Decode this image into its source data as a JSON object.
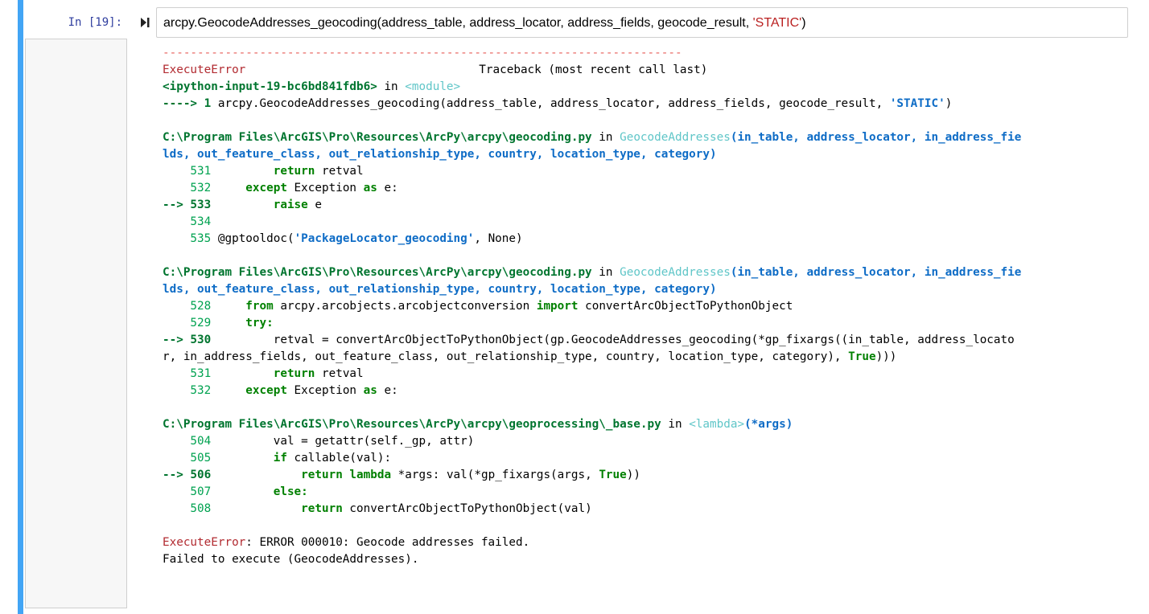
{
  "cell": {
    "prompt": "In [19]:",
    "input_parts": [
      "arcpy.GeocodeAddresses_geocoding(address_table, address_locator, address_fields, geocode_result, ",
      "'STATIC'",
      ")"
    ]
  },
  "traceback": {
    "dashes": "---------------------------------------------------------------------------",
    "error_type": "ExecuteError",
    "header_right": "Traceback (most recent call last)",
    "l3_a": "<ipython-input-19-bc6bd841fdb6>",
    "l3_b": " in ",
    "l3_c": "<module>",
    "l4_a": "----> 1 ",
    "l4_b": "arcpy.GeocodeAddresses_geocoding(address_table, address_locator, address_fields, geocode_result, ",
    "l4_c": "'STATIC'",
    "l4_d": ")",
    "f1_path": "C:\\Program Files\\ArcGIS\\Pro\\Resources\\ArcPy\\arcpy\\geocoding.py",
    "f1_in": " in ",
    "f1_func": "GeocodeAddresses",
    "f1_args1": "(in_table, address_locator, in_address_fie",
    "f1_args2": "lds, out_feature_class, out_relationship_type, country, location_type, category)",
    "f1_l1_no": "    531 ",
    "f1_l1_a": "        return",
    "f1_l1_b": " retval",
    "f1_l2_no": "    532 ",
    "f1_l2_a": "    except",
    "f1_l2_b": " Exception ",
    "f1_l2_c": "as",
    "f1_l2_d": " e:",
    "f1_l3_no": "--> 533 ",
    "f1_l3_a": "        raise",
    "f1_l3_b": " e",
    "f1_l4_no": "    534 ",
    "f1_l5_no": "    535 ",
    "f1_l5_a": "@gptooldoc(",
    "f1_l5_b": "'PackageLocator_geocoding'",
    "f1_l5_c": ", None)",
    "f2_path": "C:\\Program Files\\ArcGIS\\Pro\\Resources\\ArcPy\\arcpy\\geocoding.py",
    "f2_in": " in ",
    "f2_func": "GeocodeAddresses",
    "f2_args1": "(in_table, address_locator, in_address_fie",
    "f2_args2": "lds, out_feature_class, out_relationship_type, country, location_type, category)",
    "f2_l1_no": "    528 ",
    "f2_l1_a": "    from",
    "f2_l1_b": " arcpy.arcobjects.arcobjectconversion ",
    "f2_l1_c": "import",
    "f2_l1_d": " convertArcObjectToPythonObject",
    "f2_l2_no": "    529 ",
    "f2_l2_a": "    try:",
    "f2_l3_no": "--> 530 ",
    "f2_l3_a": "        retval = convertArcObjectToPythonObject(gp.GeocodeAddresses_geocoding(*gp_fixargs((in_table, address_locato",
    "f2_l3_b": "r, in_address_fields, out_feature_class, out_relationship_type, country, location_type, category), ",
    "f2_l3_c": "True",
    "f2_l3_d": ")))",
    "f2_l4_no": "    531 ",
    "f2_l4_a": "        return",
    "f2_l4_b": " retval",
    "f2_l5_no": "    532 ",
    "f2_l5_a": "    except",
    "f2_l5_b": " Exception ",
    "f2_l5_c": "as",
    "f2_l5_d": " e:",
    "f3_path": "C:\\Program Files\\ArcGIS\\Pro\\Resources\\ArcPy\\arcpy\\geoprocessing\\_base.py",
    "f3_in": " in ",
    "f3_func": "<lambda>",
    "f3_args": "(*args)",
    "f3_l1_no": "    504 ",
    "f3_l1_a": "        val = getattr(self._gp, attr)",
    "f3_l2_no": "    505 ",
    "f3_l2_a": "        if",
    "f3_l2_b": " callable(val):",
    "f3_l3_no": "--> 506 ",
    "f3_l3_a": "            return",
    "f3_l3_b": " lambda",
    "f3_l3_c": " *args: val(*gp_fixargs(args, ",
    "f3_l3_d": "True",
    "f3_l3_e": "))",
    "f3_l4_no": "    507 ",
    "f3_l4_a": "        else:",
    "f3_l5_no": "    508 ",
    "f3_l5_a": "            return",
    "f3_l5_b": " convertArcObjectToPythonObject(val)",
    "final_type": "ExecuteError",
    "final_msg": ": ERROR 000010: Geocode addresses failed.",
    "final_line2": "Failed to execute (GeocodeAddresses)."
  }
}
